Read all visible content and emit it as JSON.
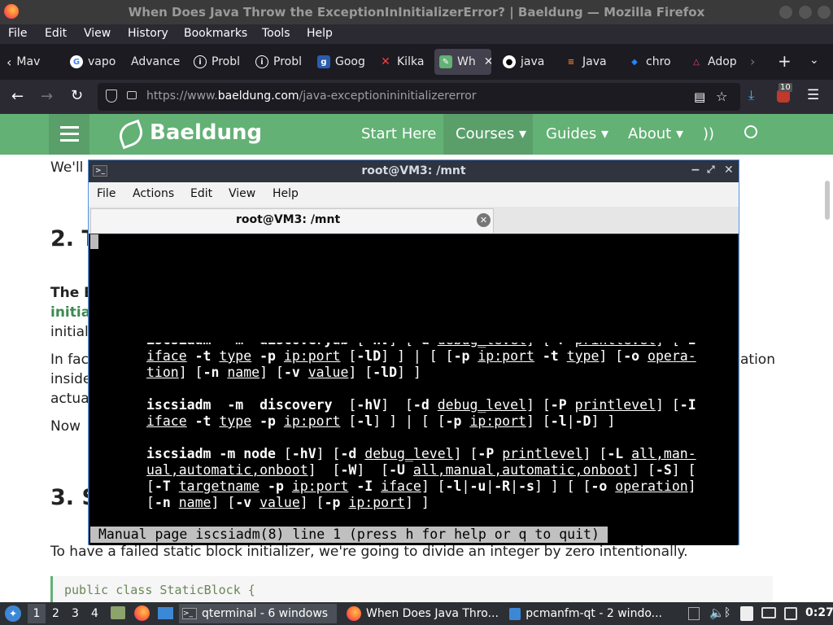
{
  "window": {
    "title": "When Does Java Throw the ExceptionInInitializerError? | Baeldung — Mozilla Firefox"
  },
  "menubar": [
    "File",
    "Edit",
    "View",
    "History",
    "Bookmarks",
    "Tools",
    "Help"
  ],
  "tabs": [
    {
      "label": "Mav",
      "icon": "page-icon"
    },
    {
      "label": "vapo",
      "icon": "google-icon"
    },
    {
      "label": "Advance",
      "icon": "page-icon"
    },
    {
      "label": "Probl",
      "icon": "info-icon"
    },
    {
      "label": "Probl",
      "icon": "info-icon"
    },
    {
      "label": "Goog",
      "icon": "google-blue-icon"
    },
    {
      "label": "Kilka",
      "icon": "kilka-icon"
    },
    {
      "label": "Wh",
      "icon": "baeldung-icon",
      "active": true
    },
    {
      "label": "java",
      "icon": "github-icon"
    },
    {
      "label": "Java",
      "icon": "stackoverflow-icon"
    },
    {
      "label": "chro",
      "icon": "jira-icon"
    },
    {
      "label": "Adop",
      "icon": "adopt-icon"
    }
  ],
  "address": {
    "prefix": "https://www.",
    "domain": "baeldung.com",
    "path": "/java-exceptionininitializererror"
  },
  "toolbar": {
    "downloads_badge": "10"
  },
  "site": {
    "logo": "Baeldung",
    "nav": [
      "Start Here",
      "Courses ▾",
      "Guides ▾",
      "About ▾"
    ]
  },
  "article": {
    "frag1": "We'll",
    "h2a": "2. T",
    "bold1": "The E",
    "link1": "initial",
    "frag2": "initial",
    "frag3a": "In fac",
    "frag3b": "ation",
    "frag4": "inside",
    "frag5": "actua",
    "frag6": "Now",
    "h2b": "3. S",
    "para": "To have a failed static block initializer, we're going to divide an integer by zero intentionally.",
    "code": "public class StaticBlock {"
  },
  "terminal": {
    "title": "root@VM3: /mnt",
    "menu": [
      "File",
      "Actions",
      "Edit",
      "View",
      "Help"
    ],
    "tab": "root@VM3: /mnt",
    "status": "Manual page iscsiadm(8) line 1 (press h for help or q to quit)"
  },
  "taskbar": {
    "workspaces": [
      "1",
      "2",
      "3",
      "4"
    ],
    "tasks": [
      "qterminal - 6 windows",
      "When Does Java Thro...",
      "pcmanfm-qt - 2 windo..."
    ],
    "clock": "0:27"
  }
}
